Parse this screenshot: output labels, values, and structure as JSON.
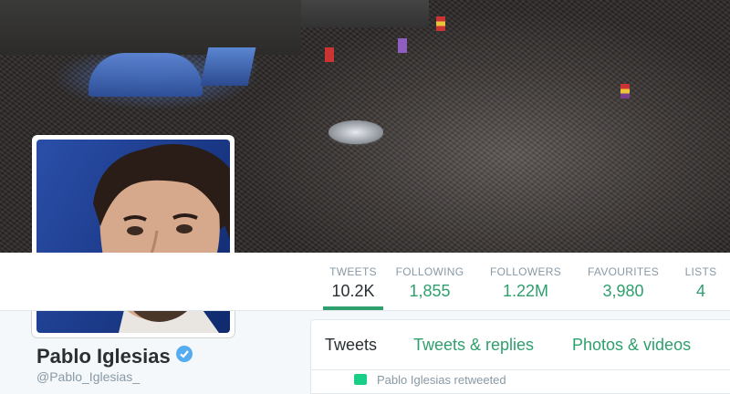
{
  "profile": {
    "name": "Pablo Iglesias",
    "handle": "@Pablo_Iglesias_",
    "verified": true,
    "accent_color": "#2e9f6d"
  },
  "stats": [
    {
      "label": "TWEETS",
      "value": "10.2K",
      "active": true
    },
    {
      "label": "FOLLOWING",
      "value": "1,855",
      "active": false
    },
    {
      "label": "FOLLOWERS",
      "value": "1.22M",
      "active": false
    },
    {
      "label": "FAVOURITES",
      "value": "3,980",
      "active": false
    },
    {
      "label": "LISTS",
      "value": "4",
      "active": false
    }
  ],
  "timeline": {
    "tabs": [
      {
        "label": "Tweets",
        "active": true
      },
      {
        "label": "Tweets & replies",
        "active": false
      },
      {
        "label": "Photos & videos",
        "active": false
      }
    ],
    "retweet_note": "Pablo Iglesias retweeted"
  }
}
